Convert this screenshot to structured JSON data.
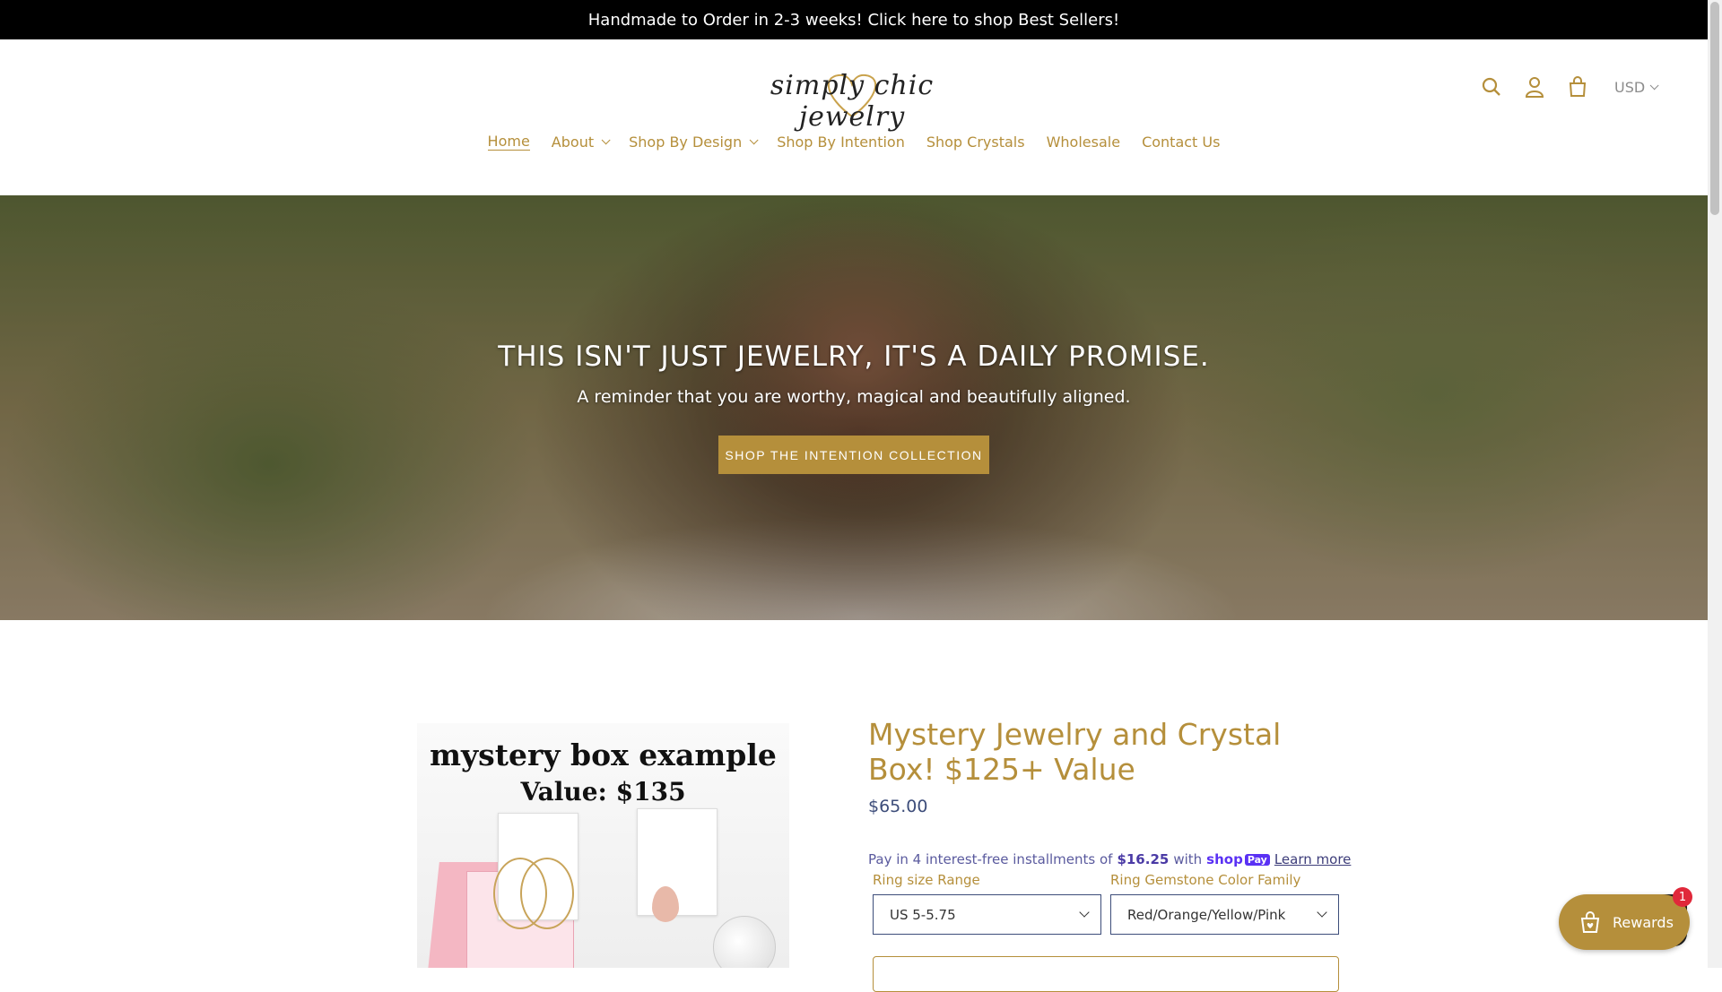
{
  "announcement": {
    "text": "Handmade to Order in 2-3 weeks! Click here to shop Best Sellers!"
  },
  "header": {
    "logo_text": "simply chic jewelry",
    "icons": [
      "search-icon",
      "account-icon",
      "cart-icon"
    ],
    "currency": "USD"
  },
  "nav": {
    "items": [
      {
        "label": "Home"
      },
      {
        "label": "About"
      },
      {
        "label": "Shop By Design"
      },
      {
        "label": "Shop By Intention"
      },
      {
        "label": "Shop Crystals"
      },
      {
        "label": "Wholesale"
      },
      {
        "label": "Contact Us"
      }
    ]
  },
  "hero": {
    "title": "THIS ISN'T JUST JEWELRY, IT'S A DAILY PROMISE.",
    "subtitle": "A reminder that you are worthy, magical and beautifully aligned.",
    "button": "SHOP THE INTENTION COLLECTION"
  },
  "product": {
    "image_title": "mystery box example",
    "image_value": "Value: $135",
    "title": "Mystery Jewelry and Crystal Box! $125+ Value",
    "price": "$65.00",
    "installments": {
      "prefix": "Pay in 4 interest-free installments of",
      "amount": "$16.25",
      "with": "with",
      "brand": "shop",
      "brand_pay": "Pay",
      "link": "Learn more"
    },
    "ring_size_label": "Ring size Range",
    "ring_size_value": "US 5-5.75",
    "gem_label": "Ring Gemstone Color Family",
    "gem_value": "Red/Orange/Yellow/Pink"
  },
  "rewards": {
    "label": "Rewards",
    "badge": "1"
  },
  "colors": {
    "accent": "#b58f3b",
    "announce_bg": "#000000",
    "price": "#3d4d7a",
    "shoppay": "#5a31f4"
  }
}
